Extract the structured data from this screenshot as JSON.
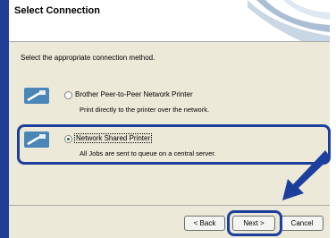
{
  "dialog": {
    "title": "Select Connection",
    "prompt": "Select the appropriate connection method."
  },
  "options": [
    {
      "label": "Brother Peer-to-Peer Network Printer",
      "description": "Print directly to the printer over the network.",
      "selected": false,
      "icon": "network-cable-icon"
    },
    {
      "label": "Network Shared Printer",
      "description": "All Jobs are sent to queue on a central server.",
      "selected": true,
      "icon": "network-cable-icon"
    }
  ],
  "buttons": {
    "back": "< Back",
    "next": "Next >",
    "cancel": "Cancel"
  },
  "annotation": {
    "highlight_color": "#1c3f9d",
    "arrow_icon": "pointer-arrow-icon"
  }
}
